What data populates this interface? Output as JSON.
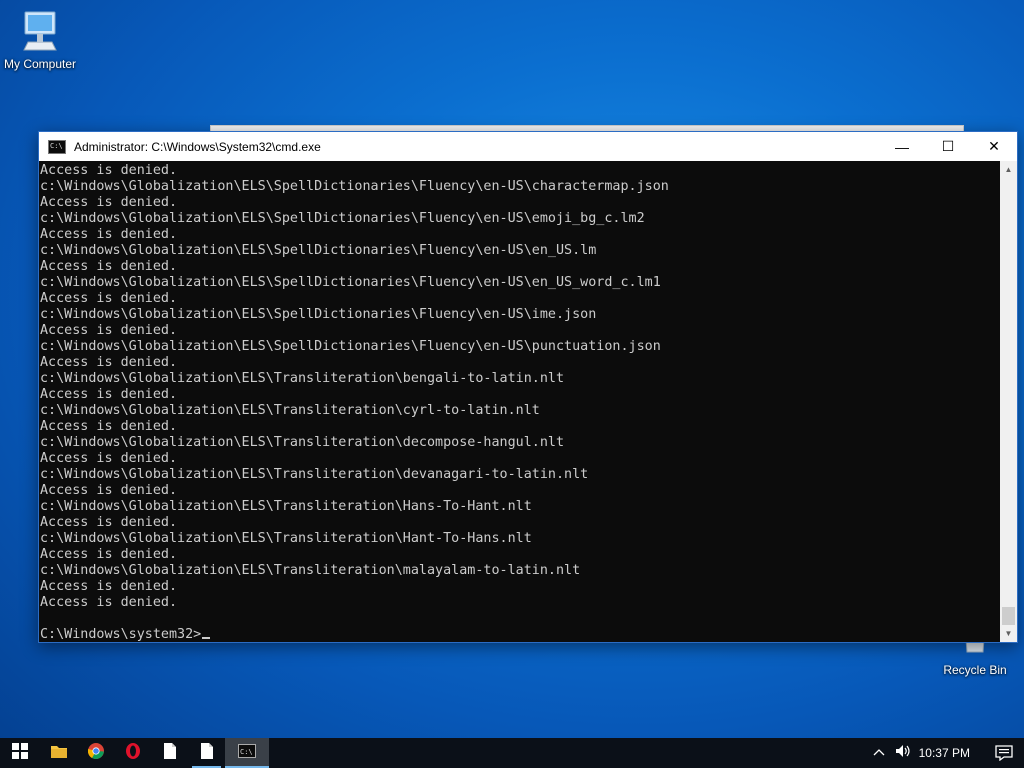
{
  "desktop": {
    "icons": [
      {
        "label": "My Computer",
        "icon": "computer-icon"
      },
      {
        "label": "Recycle Bin",
        "icon": "recycle-bin-icon"
      }
    ]
  },
  "window": {
    "title": "Administrator: C:\\Windows\\System32\\cmd.exe",
    "buttons": {
      "minimize": "—",
      "maximize": "☐",
      "close": "✕"
    }
  },
  "console": {
    "lines": [
      "Access is denied.",
      "c:\\Windows\\Globalization\\ELS\\SpellDictionaries\\Fluency\\en-US\\charactermap.json",
      "Access is denied.",
      "c:\\Windows\\Globalization\\ELS\\SpellDictionaries\\Fluency\\en-US\\emoji_bg_c.lm2",
      "Access is denied.",
      "c:\\Windows\\Globalization\\ELS\\SpellDictionaries\\Fluency\\en-US\\en_US.lm",
      "Access is denied.",
      "c:\\Windows\\Globalization\\ELS\\SpellDictionaries\\Fluency\\en-US\\en_US_word_c.lm1",
      "Access is denied.",
      "c:\\Windows\\Globalization\\ELS\\SpellDictionaries\\Fluency\\en-US\\ime.json",
      "Access is denied.",
      "c:\\Windows\\Globalization\\ELS\\SpellDictionaries\\Fluency\\en-US\\punctuation.json",
      "Access is denied.",
      "c:\\Windows\\Globalization\\ELS\\Transliteration\\bengali-to-latin.nlt",
      "Access is denied.",
      "c:\\Windows\\Globalization\\ELS\\Transliteration\\cyrl-to-latin.nlt",
      "Access is denied.",
      "c:\\Windows\\Globalization\\ELS\\Transliteration\\decompose-hangul.nlt",
      "Access is denied.",
      "c:\\Windows\\Globalization\\ELS\\Transliteration\\devanagari-to-latin.nlt",
      "Access is denied.",
      "c:\\Windows\\Globalization\\ELS\\Transliteration\\Hans-To-Hant.nlt",
      "Access is denied.",
      "c:\\Windows\\Globalization\\ELS\\Transliteration\\Hant-To-Hans.nlt",
      "Access is denied.",
      "c:\\Windows\\Globalization\\ELS\\Transliteration\\malayalam-to-latin.nlt",
      "Access is denied.",
      "Access is denied.",
      ""
    ],
    "prompt": "C:\\Windows\\system32>"
  },
  "taskbar": {
    "items": [
      {
        "name": "start-button",
        "icon": "windows-logo-icon"
      },
      {
        "name": "file-explorer",
        "icon": "folder-icon"
      },
      {
        "name": "chrome",
        "icon": "chrome-icon"
      },
      {
        "name": "opera",
        "icon": "opera-icon"
      },
      {
        "name": "document-1",
        "icon": "document-icon"
      },
      {
        "name": "document-2",
        "icon": "document-icon"
      },
      {
        "name": "cmd",
        "icon": "cmd-icon"
      }
    ],
    "clock": "10:37 PM"
  },
  "colors": {
    "console_bg": "#0c0c0c",
    "console_fg": "#cccccc",
    "taskbar_bg": "#0b1018",
    "accent": "#76b9ed"
  }
}
